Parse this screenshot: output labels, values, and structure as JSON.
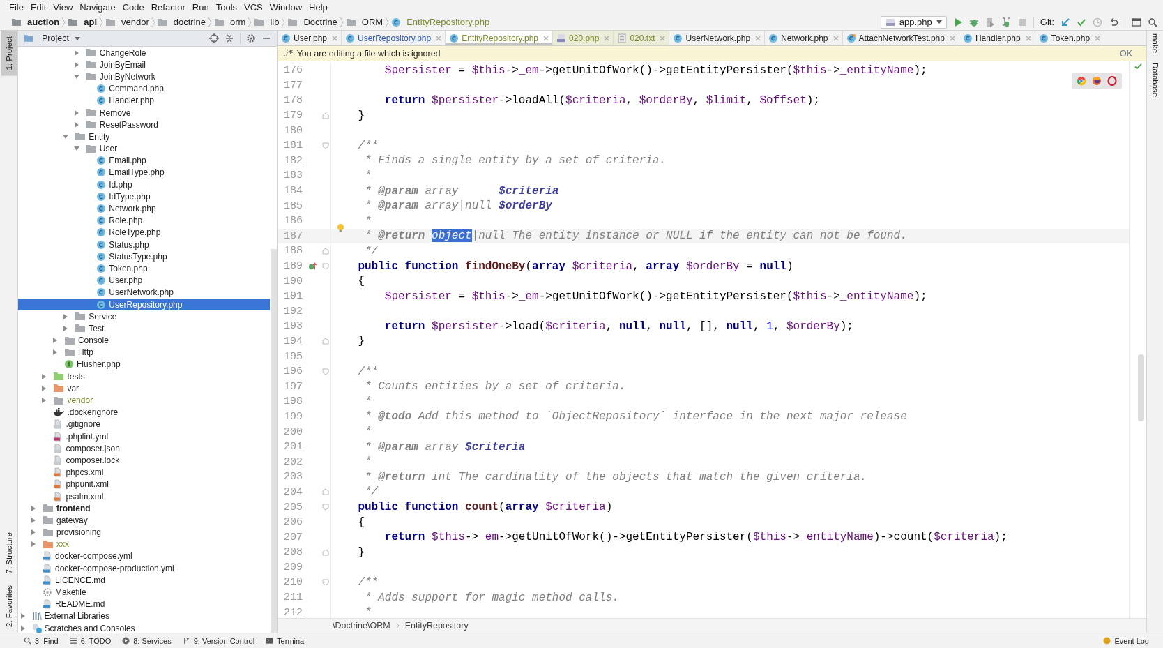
{
  "menu": [
    "File",
    "Edit",
    "View",
    "Navigate",
    "Code",
    "Refactor",
    "Run",
    "Tools",
    "VCS",
    "Window",
    "Help"
  ],
  "navbar": {
    "crumbs": [
      {
        "label": "auction",
        "kind": "module"
      },
      {
        "label": "api",
        "kind": "module"
      },
      {
        "label": "vendor",
        "kind": "folder"
      },
      {
        "label": "doctrine",
        "kind": "folder"
      },
      {
        "label": "orm",
        "kind": "folder"
      },
      {
        "label": "lib",
        "kind": "folder"
      },
      {
        "label": "Doctrine",
        "kind": "folder"
      },
      {
        "label": "ORM",
        "kind": "folder"
      },
      {
        "label": "EntityRepository.php",
        "kind": "file"
      }
    ],
    "run_config": "app.php",
    "vcs_label": "Git:"
  },
  "left_stripe": {
    "top": [
      {
        "label": "1: Project",
        "selected": true
      }
    ],
    "bottom": [
      {
        "label": "7: Structure",
        "selected": false
      },
      {
        "label": "2: Favorites",
        "selected": false
      }
    ]
  },
  "right_stripe": [
    "make",
    "Database"
  ],
  "project_panel": {
    "title": "Project"
  },
  "tree": [
    {
      "children": [
        {
          "children": [
            {
              "children": [
                {
                  "children": [
                    {
                      "children": [
                        {
                          "label": "ChangeRole",
                          "kind": "folder",
                          "expanded": false,
                          "selected": false
                        },
                        {
                          "label": "JoinByEmail",
                          "kind": "folder",
                          "expanded": false,
                          "selected": false
                        },
                        {
                          "label": "JoinByNetwork",
                          "kind": "folder",
                          "expanded": true,
                          "selected": false,
                          "children": [
                            {
                              "label": "Command.php",
                              "kind": "class",
                              "selected": false
                            },
                            {
                              "label": "Handler.php",
                              "kind": "class",
                              "selected": false
                            }
                          ]
                        },
                        {
                          "label": "Remove",
                          "kind": "folder",
                          "expanded": false,
                          "selected": false
                        },
                        {
                          "label": "ResetPassword",
                          "kind": "folder",
                          "expanded": false,
                          "selected": false
                        }
                      ]
                    },
                    {
                      "label": "Entity",
                      "kind": "folder",
                      "expanded": true,
                      "selected": false,
                      "children": [
                        {
                          "label": "User",
                          "kind": "folder",
                          "expanded": true,
                          "selected": false,
                          "children": [
                            {
                              "label": "Email.php",
                              "kind": "class",
                              "selected": false
                            },
                            {
                              "label": "EmailType.php",
                              "kind": "class",
                              "selected": false
                            },
                            {
                              "label": "Id.php",
                              "kind": "class",
                              "selected": false
                            },
                            {
                              "label": "IdType.php",
                              "kind": "class",
                              "selected": false
                            },
                            {
                              "label": "Network.php",
                              "kind": "class",
                              "selected": false
                            },
                            {
                              "label": "Role.php",
                              "kind": "class",
                              "selected": false
                            },
                            {
                              "label": "RoleType.php",
                              "kind": "class",
                              "selected": false
                            },
                            {
                              "label": "Status.php",
                              "kind": "class",
                              "selected": false
                            },
                            {
                              "label": "StatusType.php",
                              "kind": "class",
                              "selected": false
                            },
                            {
                              "label": "Token.php",
                              "kind": "class",
                              "selected": false
                            },
                            {
                              "label": "User.php",
                              "kind": "class",
                              "selected": false
                            },
                            {
                              "label": "UserNetwork.php",
                              "kind": "class",
                              "selected": false
                            },
                            {
                              "label": "UserRepository.php",
                              "kind": "class",
                              "selected": true
                            }
                          ]
                        }
                      ]
                    },
                    {
                      "label": "Service",
                      "kind": "folder",
                      "expanded": false,
                      "selected": false
                    },
                    {
                      "label": "Test",
                      "kind": "folder",
                      "expanded": false,
                      "selected": false
                    }
                  ]
                },
                {
                  "label": "Console",
                  "kind": "folder",
                  "expanded": false,
                  "selected": false
                },
                {
                  "label": "Http",
                  "kind": "folder",
                  "expanded": false,
                  "selected": false
                },
                {
                  "label": "Flusher.php",
                  "kind": "interface",
                  "selected": false
                }
              ]
            },
            {
              "label": "tests",
              "kind": "folder",
              "expanded": false,
              "selected": false,
              "color": "#8fcf6f"
            },
            {
              "label": "var",
              "kind": "folder",
              "expanded": false,
              "selected": false,
              "color": "#e8956a"
            },
            {
              "label": "vendor",
              "kind": "folder",
              "expanded": false,
              "selected": false,
              "ignored": true
            },
            {
              "label": ".dockerignore",
              "kind": "docker",
              "selected": false
            },
            {
              "label": ".gitignore",
              "kind": "config",
              "selected": false
            },
            {
              "label": ".phplint.yml",
              "kind": "yml",
              "selected": false
            },
            {
              "label": "composer.json",
              "kind": "config",
              "selected": false
            },
            {
              "label": "composer.lock",
              "kind": "config",
              "selected": false
            },
            {
              "label": "phpcs.xml",
              "kind": "xml",
              "selected": false
            },
            {
              "label": "phpunit.xml",
              "kind": "xml",
              "selected": false
            },
            {
              "label": "psalm.xml",
              "kind": "xml",
              "selected": false
            }
          ]
        },
        {
          "label": "frontend",
          "kind": "folder",
          "expanded": false,
          "selected": false,
          "bold": true
        },
        {
          "label": "gateway",
          "kind": "folder",
          "expanded": false,
          "selected": false
        },
        {
          "label": "provisioning",
          "kind": "folder",
          "expanded": false,
          "selected": false
        },
        {
          "label": "xxx",
          "kind": "folder",
          "expanded": false,
          "selected": false,
          "color": "#e8956a",
          "ignored": true
        },
        {
          "label": "docker-compose.yml",
          "kind": "compose",
          "selected": false
        },
        {
          "label": "docker-compose-production.yml",
          "kind": "compose",
          "selected": false
        },
        {
          "label": "LICENCE.md",
          "kind": "markdown",
          "selected": false
        },
        {
          "label": "Makefile",
          "kind": "makefile",
          "selected": false
        },
        {
          "label": "README.md",
          "kind": "markdown",
          "selected": false
        }
      ]
    },
    {
      "label": "External Libraries",
      "kind": "libraries",
      "expanded": false,
      "selected": false
    },
    {
      "label": "Scratches and Consoles",
      "kind": "scratches",
      "expanded": false,
      "selected": false
    }
  ],
  "tabs": [
    {
      "label": "User.php",
      "kind": "class",
      "modified": false,
      "ignored": false,
      "selected": false
    },
    {
      "label": "UserRepository.php",
      "kind": "class",
      "modified": true,
      "ignored": false,
      "selected": false
    },
    {
      "label": "EntityRepository.php",
      "kind": "class",
      "modified": false,
      "ignored": true,
      "selected": true
    },
    {
      "label": "020.php",
      "kind": "php",
      "modified": false,
      "ignored": true,
      "selected": false
    },
    {
      "label": "020.txt",
      "kind": "text",
      "modified": false,
      "ignored": true,
      "selected": false
    },
    {
      "label": "UserNetwork.php",
      "kind": "class",
      "modified": false,
      "ignored": false,
      "selected": false
    },
    {
      "label": "Network.php",
      "kind": "class",
      "modified": false,
      "ignored": false,
      "selected": false
    },
    {
      "label": "AttachNetworkTest.php",
      "kind": "test",
      "modified": false,
      "ignored": false,
      "selected": false
    },
    {
      "label": "Handler.php",
      "kind": "class",
      "modified": false,
      "ignored": false,
      "selected": false
    },
    {
      "label": "Token.php",
      "kind": "class",
      "modified": false,
      "ignored": false,
      "selected": false
    }
  ],
  "notice": {
    "marker": ".i*",
    "message": "You are editing a file which is ignored",
    "action": "OK"
  },
  "code": [
    {
      "number": "176",
      "tokens": [
        {
          "kind": "var",
          "text": "        $persister"
        },
        {
          "kind": "plain",
          "text": " = "
        },
        {
          "kind": "var",
          "text": "$this"
        },
        {
          "kind": "plain",
          "text": "->"
        },
        {
          "kind": "field",
          "text": "_em"
        },
        {
          "kind": "plain",
          "text": "->getUnitOfWork()->getEntityPersister("
        },
        {
          "kind": "var",
          "text": "$this"
        },
        {
          "kind": "plain",
          "text": "->"
        },
        {
          "kind": "field",
          "text": "_entityName"
        },
        {
          "kind": "plain",
          "text": ");"
        }
      ]
    },
    {
      "number": "177"
    },
    {
      "number": "178",
      "tokens": [
        {
          "kind": "keyword",
          "text": "        return "
        },
        {
          "kind": "var",
          "text": "$persister"
        },
        {
          "kind": "plain",
          "text": "->loadAll("
        },
        {
          "kind": "var",
          "text": "$criteria"
        },
        {
          "kind": "plain",
          "text": ", "
        },
        {
          "kind": "var",
          "text": "$orderBy"
        },
        {
          "kind": "plain",
          "text": ", "
        },
        {
          "kind": "var",
          "text": "$limit"
        },
        {
          "kind": "plain",
          "text": ", "
        },
        {
          "kind": "var",
          "text": "$offset"
        },
        {
          "kind": "plain",
          "text": ");"
        }
      ]
    },
    {
      "number": "179",
      "fold_end": true,
      "tokens": [
        {
          "kind": "plain",
          "text": "    }"
        }
      ]
    },
    {
      "number": "180"
    },
    {
      "number": "181",
      "fold_start": true,
      "tokens": [
        {
          "kind": "comment",
          "text": "    /**"
        }
      ]
    },
    {
      "number": "182",
      "tokens": [
        {
          "kind": "comment",
          "text": "     * Finds a single entity by a set of criteria."
        }
      ]
    },
    {
      "number": "183",
      "tokens": [
        {
          "kind": "comment",
          "text": "     *"
        }
      ]
    },
    {
      "number": "184",
      "tokens": [
        {
          "kind": "comment",
          "text": "     * "
        },
        {
          "kind": "doctag",
          "text": "@param"
        },
        {
          "kind": "comment",
          "text": " array      "
        },
        {
          "kind": "docvar",
          "text": "$criteria"
        }
      ]
    },
    {
      "number": "185",
      "tokens": [
        {
          "kind": "comment",
          "text": "     * "
        },
        {
          "kind": "doctag",
          "text": "@param"
        },
        {
          "kind": "comment",
          "text": " array|null "
        },
        {
          "kind": "docvar",
          "text": "$orderBy"
        }
      ]
    },
    {
      "number": "186",
      "tokens": [
        {
          "kind": "comment",
          "text": "     *"
        }
      ]
    },
    {
      "number": "187",
      "current": true,
      "bulb": true,
      "tokens": [
        {
          "kind": "comment",
          "text": "     * "
        },
        {
          "kind": "doctag",
          "text": "@return "
        },
        {
          "kind": "selection",
          "text": "object"
        },
        {
          "kind": "comment",
          "text": "|null The entity instance or NULL if the entity can not be found."
        }
      ]
    },
    {
      "number": "188",
      "fold_end": true,
      "tokens": [
        {
          "kind": "comment",
          "text": "     */"
        }
      ]
    },
    {
      "number": "189",
      "fold_start": true,
      "override": true,
      "tokens": [
        {
          "kind": "keyword",
          "text": "    public function "
        },
        {
          "kind": "function",
          "text": "findOneBy"
        },
        {
          "kind": "plain",
          "text": "("
        },
        {
          "kind": "keyword",
          "text": "array "
        },
        {
          "kind": "var",
          "text": "$criteria"
        },
        {
          "kind": "plain",
          "text": ", "
        },
        {
          "kind": "keyword",
          "text": "array "
        },
        {
          "kind": "var",
          "text": "$orderBy"
        },
        {
          "kind": "plain",
          "text": " = "
        },
        {
          "kind": "keyword",
          "text": "null"
        },
        {
          "kind": "plain",
          "text": ")"
        }
      ]
    },
    {
      "number": "190",
      "tokens": [
        {
          "kind": "plain",
          "text": "    {"
        }
      ]
    },
    {
      "number": "191",
      "tokens": [
        {
          "kind": "var",
          "text": "        $persister"
        },
        {
          "kind": "plain",
          "text": " = "
        },
        {
          "kind": "var",
          "text": "$this"
        },
        {
          "kind": "plain",
          "text": "->"
        },
        {
          "kind": "field",
          "text": "_em"
        },
        {
          "kind": "plain",
          "text": "->getUnitOfWork()->getEntityPersister("
        },
        {
          "kind": "var",
          "text": "$this"
        },
        {
          "kind": "plain",
          "text": "->"
        },
        {
          "kind": "field",
          "text": "_entityName"
        },
        {
          "kind": "plain",
          "text": ");"
        }
      ]
    },
    {
      "number": "192"
    },
    {
      "number": "193",
      "tokens": [
        {
          "kind": "keyword",
          "text": "        return "
        },
        {
          "kind": "var",
          "text": "$persister"
        },
        {
          "kind": "plain",
          "text": "->load("
        },
        {
          "kind": "var",
          "text": "$criteria"
        },
        {
          "kind": "plain",
          "text": ", "
        },
        {
          "kind": "keyword",
          "text": "null"
        },
        {
          "kind": "plain",
          "text": ", "
        },
        {
          "kind": "keyword",
          "text": "null"
        },
        {
          "kind": "plain",
          "text": ", [], "
        },
        {
          "kind": "keyword",
          "text": "null"
        },
        {
          "kind": "plain",
          "text": ", "
        },
        {
          "kind": "number",
          "text": "1"
        },
        {
          "kind": "plain",
          "text": ", "
        },
        {
          "kind": "var",
          "text": "$orderBy"
        },
        {
          "kind": "plain",
          "text": ");"
        }
      ]
    },
    {
      "number": "194",
      "fold_end": true,
      "tokens": [
        {
          "kind": "plain",
          "text": "    }"
        }
      ]
    },
    {
      "number": "195"
    },
    {
      "number": "196",
      "fold_start": true,
      "tokens": [
        {
          "kind": "comment",
          "text": "    /**"
        }
      ]
    },
    {
      "number": "197",
      "tokens": [
        {
          "kind": "comment",
          "text": "     * Counts entities by a set of criteria."
        }
      ]
    },
    {
      "number": "198",
      "tokens": [
        {
          "kind": "comment",
          "text": "     *"
        }
      ]
    },
    {
      "number": "199",
      "tokens": [
        {
          "kind": "comment",
          "text": "     * "
        },
        {
          "kind": "doctag",
          "text": "@todo"
        },
        {
          "kind": "comment",
          "text": " Add this method to `ObjectRepository` interface in the next major release"
        }
      ]
    },
    {
      "number": "200",
      "tokens": [
        {
          "kind": "comment",
          "text": "     *"
        }
      ]
    },
    {
      "number": "201",
      "tokens": [
        {
          "kind": "comment",
          "text": "     * "
        },
        {
          "kind": "doctag",
          "text": "@param"
        },
        {
          "kind": "comment",
          "text": " array "
        },
        {
          "kind": "docvar",
          "text": "$criteria"
        }
      ]
    },
    {
      "number": "202",
      "tokens": [
        {
          "kind": "comment",
          "text": "     *"
        }
      ]
    },
    {
      "number": "203",
      "tokens": [
        {
          "kind": "comment",
          "text": "     * "
        },
        {
          "kind": "doctag",
          "text": "@return"
        },
        {
          "kind": "comment",
          "text": " int The cardinality of the objects that match the given criteria."
        }
      ]
    },
    {
      "number": "204",
      "fold_end": true,
      "tokens": [
        {
          "kind": "comment",
          "text": "     */"
        }
      ]
    },
    {
      "number": "205",
      "fold_start": true,
      "tokens": [
        {
          "kind": "keyword",
          "text": "    public function "
        },
        {
          "kind": "function",
          "text": "count"
        },
        {
          "kind": "plain",
          "text": "("
        },
        {
          "kind": "keyword",
          "text": "array "
        },
        {
          "kind": "var",
          "text": "$criteria"
        },
        {
          "kind": "plain",
          "text": ")"
        }
      ]
    },
    {
      "number": "206",
      "tokens": [
        {
          "kind": "plain",
          "text": "    {"
        }
      ]
    },
    {
      "number": "207",
      "tokens": [
        {
          "kind": "keyword",
          "text": "        return "
        },
        {
          "kind": "var",
          "text": "$this"
        },
        {
          "kind": "plain",
          "text": "->"
        },
        {
          "kind": "field",
          "text": "_em"
        },
        {
          "kind": "plain",
          "text": "->getUnitOfWork()->getEntityPersister("
        },
        {
          "kind": "var",
          "text": "$this"
        },
        {
          "kind": "plain",
          "text": "->"
        },
        {
          "kind": "field",
          "text": "_entityName"
        },
        {
          "kind": "plain",
          "text": ")->count("
        },
        {
          "kind": "var",
          "text": "$criteria"
        },
        {
          "kind": "plain",
          "text": ");"
        }
      ]
    },
    {
      "number": "208",
      "fold_end": true,
      "tokens": [
        {
          "kind": "plain",
          "text": "    }"
        }
      ]
    },
    {
      "number": "209"
    },
    {
      "number": "210",
      "fold_start": true,
      "tokens": [
        {
          "kind": "comment",
          "text": "    /**"
        }
      ]
    },
    {
      "number": "211",
      "tokens": [
        {
          "kind": "comment",
          "text": "     * Adds support for magic method calls."
        }
      ]
    },
    {
      "number": "212",
      "tokens": [
        {
          "kind": "comment",
          "text": "     *"
        }
      ]
    }
  ],
  "editor_breadcrumb": [
    "\\Doctrine\\ORM",
    "EntityRepository"
  ],
  "status_bar": {
    "tools": [
      {
        "label": "3: Find",
        "kind": "find"
      },
      {
        "label": "6: TODO",
        "kind": "todo"
      },
      {
        "label": "8: Services",
        "kind": "services"
      },
      {
        "label": "9: Version Control",
        "kind": "vcs"
      },
      {
        "label": "Terminal",
        "kind": "terminal"
      }
    ],
    "event_log": "Event Log"
  }
}
